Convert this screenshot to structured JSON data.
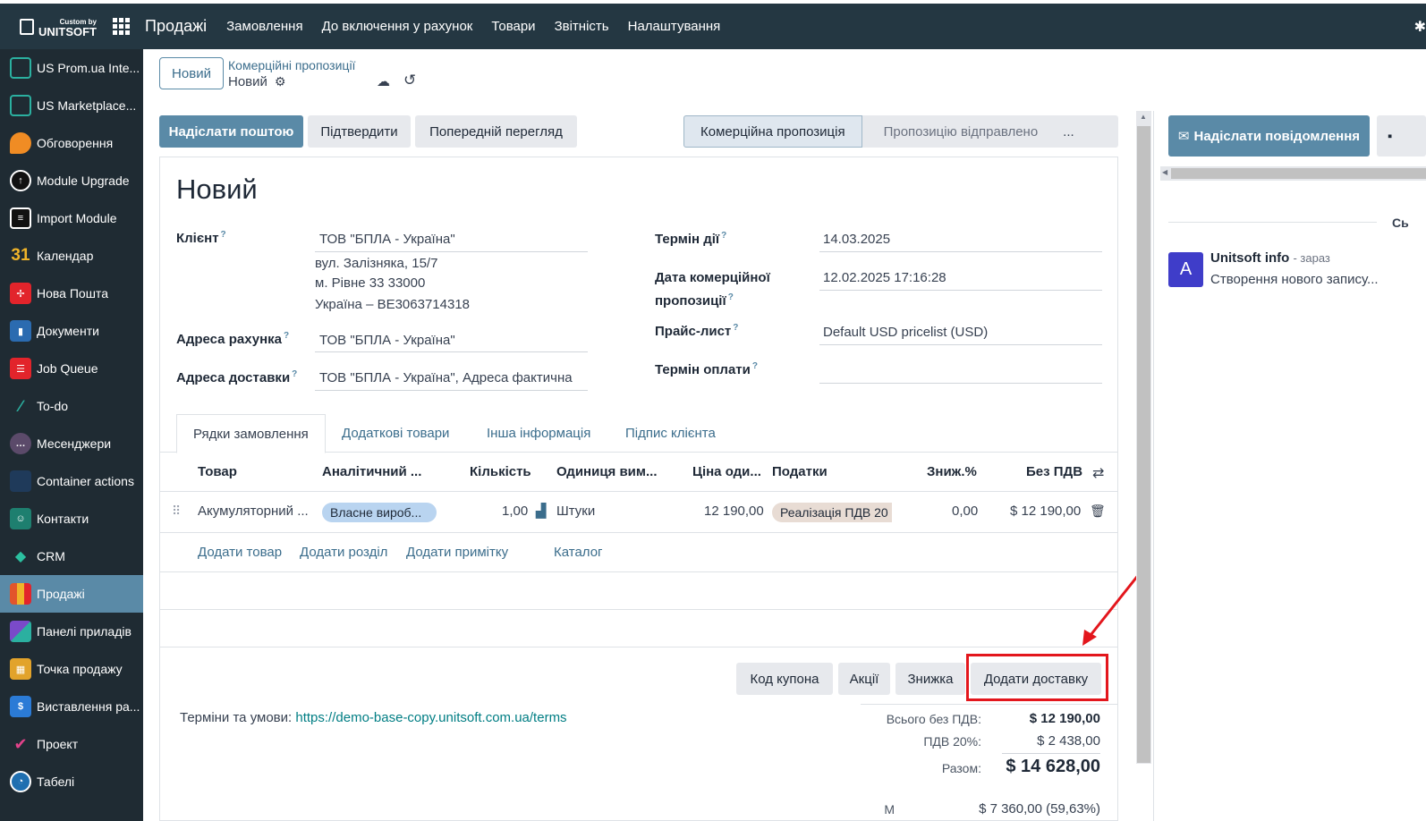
{
  "topbar": {
    "brand_small": "Custom by",
    "brand_big": "UNITSOFT",
    "app_name": "Продажі",
    "menu": [
      "Замовлення",
      "До включення у рахунок",
      "Товари",
      "Звітність",
      "Налаштування"
    ]
  },
  "sidebar": {
    "items": [
      {
        "label": "US Prom.ua Inte...",
        "color": "#1f2b33"
      },
      {
        "label": "US Marketplace...",
        "color": "#1f2b33"
      },
      {
        "label": "Обговорення",
        "color": "#f08c24"
      },
      {
        "label": "Module Upgrade",
        "color": "#111111"
      },
      {
        "label": "Import Module",
        "color": "#111111"
      },
      {
        "label": "Календар",
        "color": "#1f2b33"
      },
      {
        "label": "Нова Пошта",
        "color": "#e2242b"
      },
      {
        "label": "Документи",
        "color": "#2b6bb0"
      },
      {
        "label": "Job Queue",
        "color": "#e2242b"
      },
      {
        "label": "To-do",
        "color": "#1f2b33"
      },
      {
        "label": "Месенджери",
        "color": "#5b4a6a"
      },
      {
        "label": "Container actions",
        "color": "#1f3a5a"
      },
      {
        "label": "Контакти",
        "color": "#1e7f6f"
      },
      {
        "label": "CRM",
        "color": "#1f2b33"
      },
      {
        "label": "Продажі",
        "color": "#e2552b"
      },
      {
        "label": "Панелі приладів",
        "color": "#1f2b33"
      },
      {
        "label": "Точка продажу",
        "color": "#e2a32b"
      },
      {
        "label": "Виставлення ра...",
        "color": "#2b7bd6"
      },
      {
        "label": "Проект",
        "color": "#1f2b33"
      },
      {
        "label": "Табелі",
        "color": "#1f6fb0"
      }
    ],
    "calendar_digits": "31"
  },
  "control": {
    "new_button": "Новий",
    "breadcrumb_parent": "Комерційні пропозиції",
    "breadcrumb_current": "Новий"
  },
  "actions": {
    "send_email": "Надіслати поштою",
    "confirm": "Підтвердити",
    "preview": "Попередній перегляд"
  },
  "status": {
    "active": "Комерційна пропозиція",
    "next": "Пропозицію відправлено",
    "more": "..."
  },
  "form": {
    "title": "Новий",
    "customer_label": "Клієнт",
    "customer_value": "ТОВ \"БПЛА - Україна\"",
    "address_lines": [
      "вул. Залізняка, 15/7",
      "м. Рівне 33 33000",
      "Україна – BE3063714318"
    ],
    "invoice_label": "Адреса рахунка",
    "invoice_value": "ТОВ \"БПЛА - Україна\"",
    "delivery_label": "Адреса доставки",
    "delivery_value": "ТОВ \"БПЛА - Україна\", Адреса фактична",
    "validity_label": "Термін дії",
    "validity_value": "14.03.2025",
    "date_label_1": "Дата комерційної",
    "date_label_2": "пропозиції",
    "date_value": "12.02.2025 17:16:28",
    "pricelist_label": "Прайс-лист",
    "pricelist_value": "Default USD pricelist (USD)",
    "payment_label": "Термін оплати",
    "help_mark": "?"
  },
  "tabs": [
    "Рядки замовлення",
    "Додаткові товари",
    "Інша інформація",
    "Підпис клієнта"
  ],
  "table": {
    "headers": [
      "Товар",
      "Аналітичний ...",
      "Кількість",
      "Одиниця вим...",
      "Ціна оди...",
      "Податки",
      "Зниж.%",
      "Без ПДВ"
    ],
    "row": {
      "product": "Акумуляторний ...",
      "analytic": "Власне вироб...",
      "qty": "1,00",
      "uom": "Штуки",
      "price": "12 190,00",
      "tax": "Реалізація ПДВ 20",
      "discount": "0,00",
      "subtotal": "$ 12 190,00"
    },
    "add_links": [
      "Додати товар",
      "Додати розділ",
      "Додати примітку",
      "Каталог"
    ]
  },
  "bottom_buttons": [
    "Код купона",
    "Акції",
    "Знижка",
    "Додати доставку"
  ],
  "terms": {
    "label": "Терміни та умови:",
    "url": "https://demo-base-copy.unitsoft.com.ua/terms"
  },
  "totals": {
    "untaxed_label": "Всього без ПДВ:",
    "untaxed_value": "$ 12 190,00",
    "vat_label": "ПДВ 20%:",
    "vat_value": "$ 2 438,00",
    "total_label": "Разом:",
    "total_value": "$ 14 628,00",
    "cut_label": "М",
    "cut_value": "$ 7 360,00 (59,63%)"
  },
  "chatter": {
    "send_message": "Надіслати повідомлення",
    "separator_text": "Сь",
    "avatar_letter": "A",
    "author": "Unitsoft info",
    "time": "- зараз",
    "message": "Створення нового запису..."
  },
  "colors": {
    "topbar": "#243742",
    "sidebar": "#1f2b33",
    "primary": "#5a8aa7",
    "highlight": "#e3161c",
    "avatar": "#3f3dc9"
  }
}
